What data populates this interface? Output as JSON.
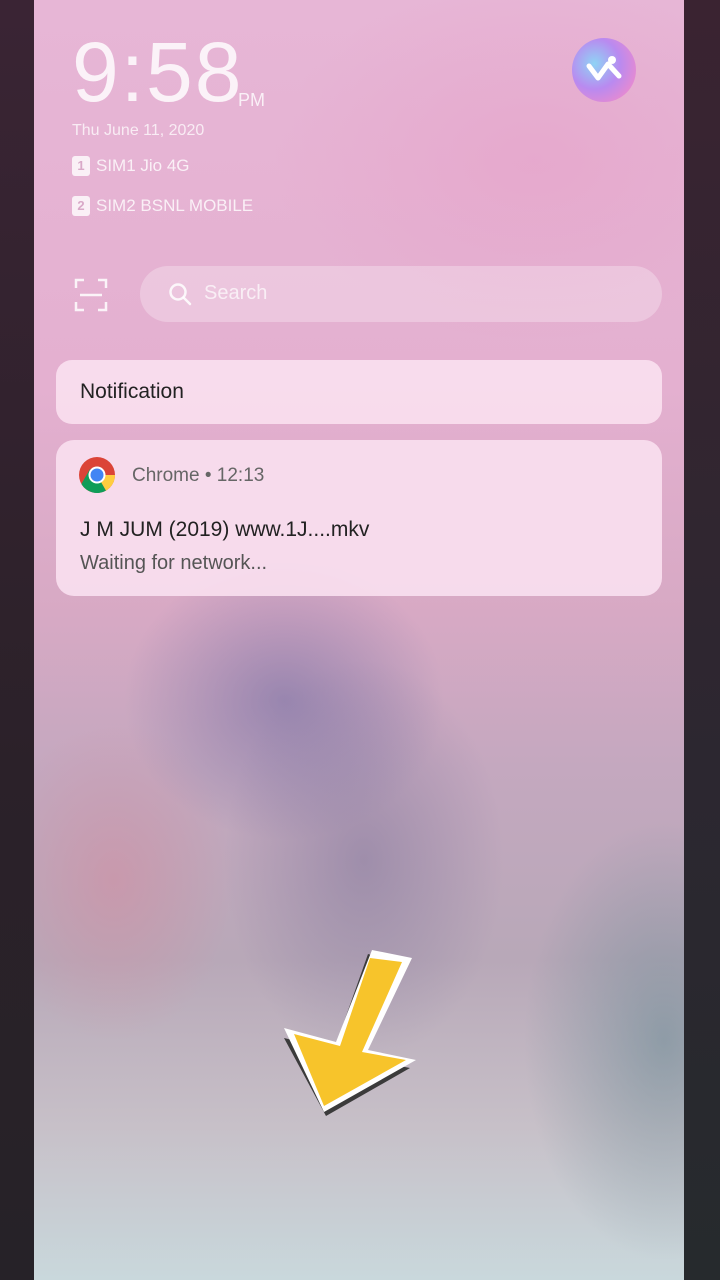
{
  "status": {
    "time": "9:58",
    "ampm": "PM",
    "date": "Thu June 11, 2020",
    "sims": [
      {
        "slot": "1",
        "label": "SIM1 Jio 4G"
      },
      {
        "slot": "2",
        "label": "SIM2 BSNL MOBILE"
      }
    ]
  },
  "search": {
    "placeholder": "Search"
  },
  "notification_header": {
    "label": "Notification"
  },
  "notifications": [
    {
      "app": "Chrome",
      "separator": "•",
      "time": "12:13",
      "title": "J M JUM (2019) www.1J....mkv",
      "body": "Waiting for network..."
    }
  ],
  "colors": {
    "arrow": "#f7c42b",
    "card_background": "#f9e0ef"
  }
}
